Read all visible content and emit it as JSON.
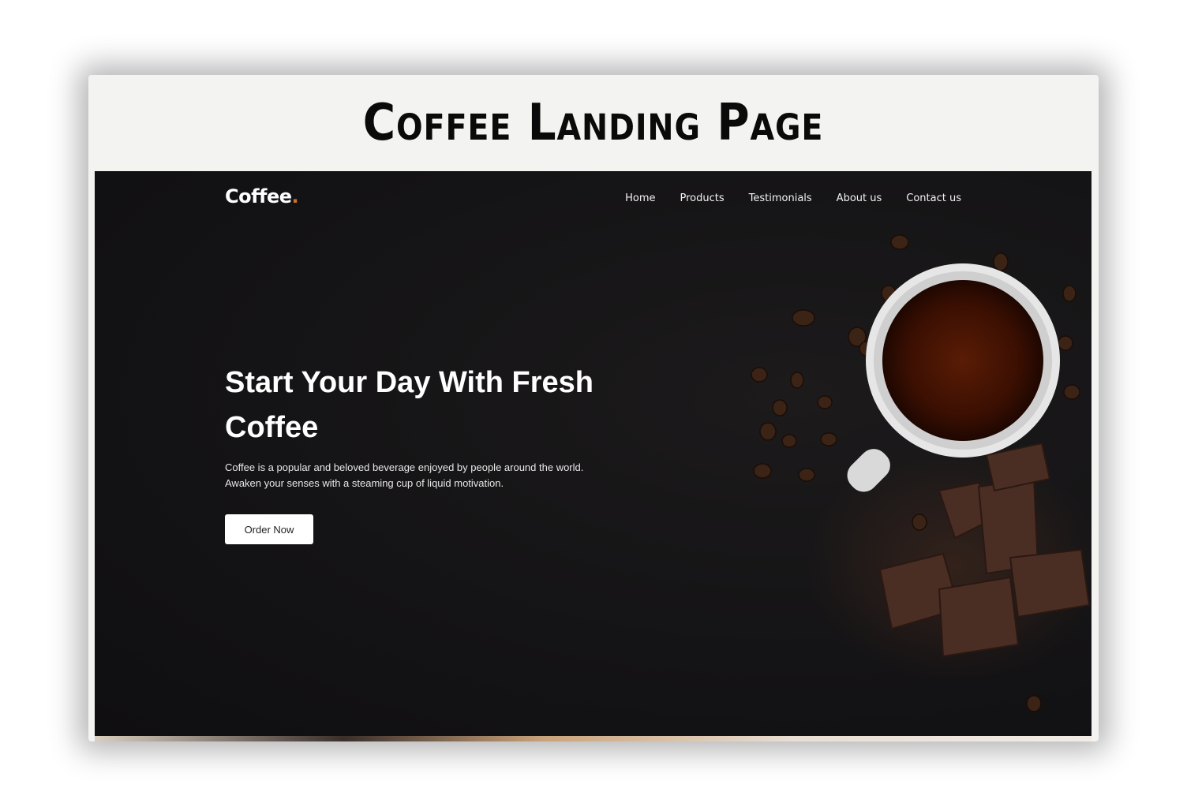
{
  "banner": {
    "title": "Coffee Landing Page"
  },
  "site": {
    "logo": {
      "text": "Coffee",
      "dot": "."
    },
    "nav": [
      "Home",
      "Products",
      "Testimonials",
      "About us",
      "Contact us"
    ],
    "hero": {
      "title": "Start Your Day With Fresh Coffee",
      "description": "Coffee is a popular and beloved beverage enjoyed by people around the world. Awaken your senses with a steaming cup of liquid motivation.",
      "cta_label": "Order Now"
    }
  },
  "colors": {
    "background": "#141315",
    "text": "#ffffff",
    "accent": "#c8762e",
    "button_bg": "#ffffff",
    "coffee": "#3a0f02"
  }
}
